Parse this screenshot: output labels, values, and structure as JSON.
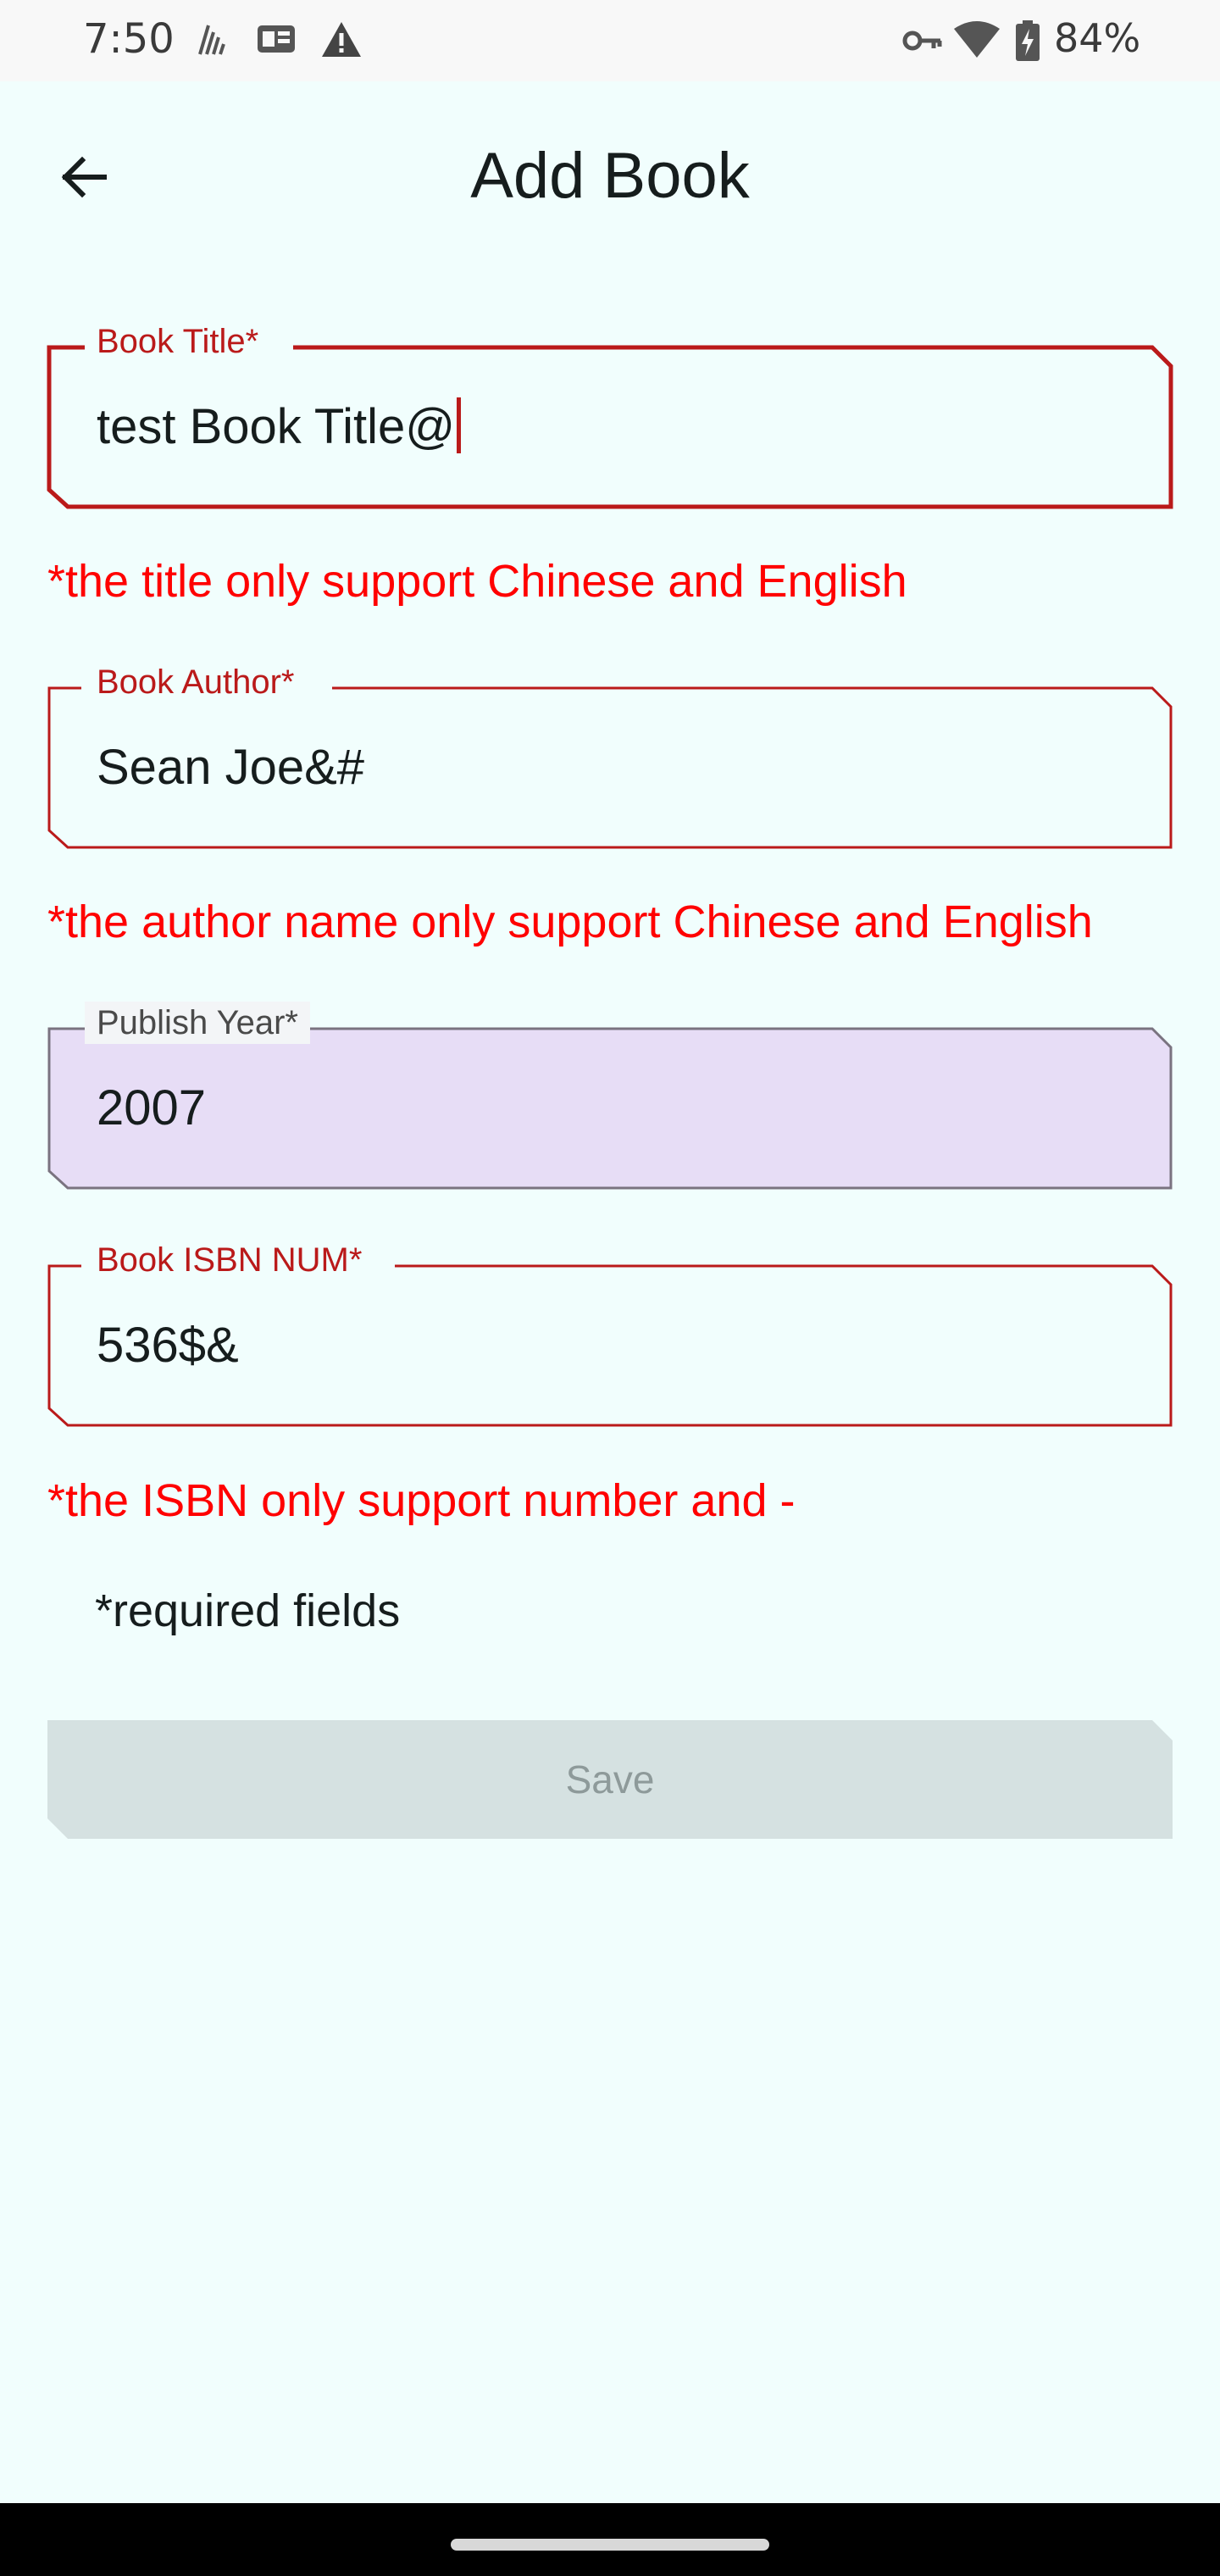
{
  "status_bar": {
    "time": "7:50",
    "battery": "84%",
    "icons": [
      "signal-icon",
      "news-icon",
      "warning-icon",
      "vpn-key-icon",
      "wifi-icon",
      "battery-charging-icon"
    ]
  },
  "app_bar": {
    "title": "Add Book",
    "back_icon": "arrow-back-icon"
  },
  "form": {
    "title_field": {
      "label": "Book Title*",
      "value": "test Book Title@",
      "error": "*the title only support Chinese and English"
    },
    "author_field": {
      "label": "Book Author*",
      "value": "Sean Joe&#",
      "error": "*the author name only support Chinese and English"
    },
    "year_field": {
      "label": "Publish Year*",
      "value": "2007"
    },
    "isbn_field": {
      "label": "Book ISBN NUM*",
      "value": "536$&",
      "error": "*the ISBN only support number and -"
    },
    "required_note": "*required fields",
    "save_label": "Save"
  },
  "colors": {
    "background": "#f1fefd",
    "error": "#ff0000",
    "error_outline": "#ba1a1a",
    "filled_field": "#e7ddf6",
    "disabled_button": "#d5e1e1"
  }
}
